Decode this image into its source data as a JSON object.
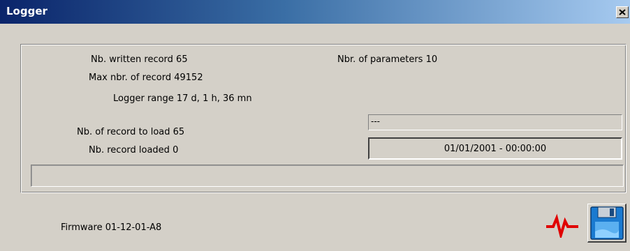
{
  "window": {
    "title": "Logger",
    "close_label": "×"
  },
  "info": {
    "written_record": "Nb. written record 65",
    "max_record": "Max nbr. of record 49152",
    "logger_range": "Logger range  17 d, 1 h, 36 mn",
    "nbr_parameters": "Nbr. of parameters  10",
    "records_to_load": "Nb. of record to load 65",
    "records_loaded": "Nb. record loaded 0",
    "firmware": "Firmware  01-12-01-A8"
  },
  "fields": {
    "status_text": "---",
    "datetime": "01/01/2001 - 00:00:00"
  },
  "progress": {
    "fraction": 0
  },
  "icons": {
    "signal": "signal-waveform-icon",
    "save": "floppy-disk-save-icon"
  },
  "colors": {
    "title_gradient_start": "#0a246a",
    "title_gradient_end": "#a6caf0",
    "window_bg": "#d4d0c8",
    "signal_red": "#e00000",
    "disk_blue": "#1a7ad0"
  }
}
